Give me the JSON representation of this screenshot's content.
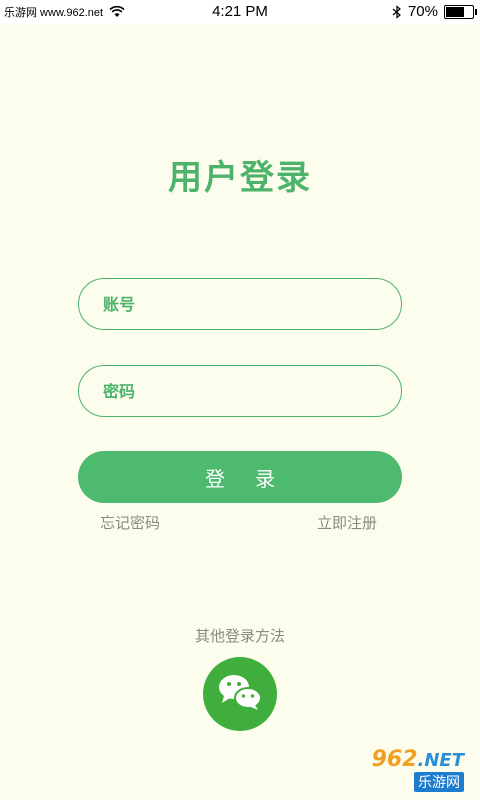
{
  "status_bar": {
    "site_text": "乐游网 www.962.net",
    "time": "4:21 PM",
    "battery": "70%",
    "battery_level": 0.7
  },
  "title": "用户登录",
  "fields": {
    "account_placeholder": "账号",
    "password_placeholder": "密码"
  },
  "login_button_label": "登录",
  "links": {
    "forgot_password": "忘记密码",
    "register": "立即注册"
  },
  "other_login_label": "其他登录方法",
  "wechat_icon": "wechat-icon",
  "watermark": {
    "brand": "962",
    "suffix": ".NET",
    "name": "乐游网"
  },
  "colors": {
    "background": "#fdfdee",
    "accent": "#4cb36a",
    "wechat": "#3fae3c"
  }
}
